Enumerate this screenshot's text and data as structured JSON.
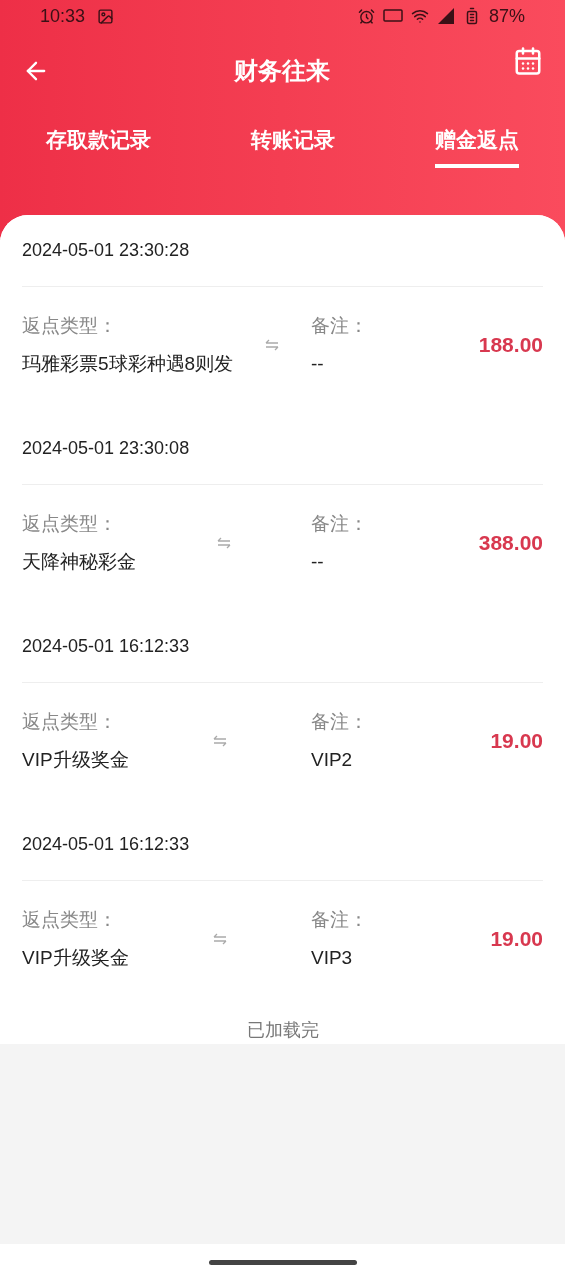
{
  "status_bar": {
    "time": "10:33",
    "battery": "87%"
  },
  "header": {
    "title": "财务往来"
  },
  "tabs": [
    {
      "label": "存取款记录",
      "selected": false
    },
    {
      "label": "转账记录",
      "selected": false
    },
    {
      "label": "赠金返点",
      "selected": true
    }
  ],
  "records": [
    {
      "datetime": "2024-05-01 23:30:28",
      "type_label": "返点类型：",
      "type_value": "玛雅彩票5球彩种遇8则发",
      "note_label": "备注：",
      "note_value": "--",
      "amount": "188.00"
    },
    {
      "datetime": "2024-05-01 23:30:08",
      "type_label": "返点类型：",
      "type_value": "天降神秘彩金",
      "note_label": "备注：",
      "note_value": "--",
      "amount": "388.00"
    },
    {
      "datetime": "2024-05-01 16:12:33",
      "type_label": "返点类型：",
      "type_value": "VIP升级奖金",
      "note_label": "备注：",
      "note_value": "VIP2",
      "amount": "19.00"
    },
    {
      "datetime": "2024-05-01 16:12:33",
      "type_label": "返点类型：",
      "type_value": "VIP升级奖金",
      "note_label": "备注：",
      "note_value": "VIP3",
      "amount": "19.00"
    }
  ],
  "footer": "已加载完"
}
